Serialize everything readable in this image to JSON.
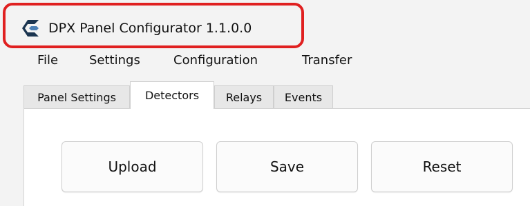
{
  "window": {
    "title": "DPX Panel Configurator 1.1.0.0",
    "icon": "app-logo-icon",
    "highlight_color": "#e02020"
  },
  "menu": {
    "items": [
      "File",
      "Settings",
      "Configuration",
      "Transfer"
    ]
  },
  "tabs": {
    "items": [
      "Panel Settings",
      "Detectors",
      "Relays",
      "Events"
    ],
    "active": "Detectors"
  },
  "buttons": {
    "upload_label": "Upload",
    "save_label": "Save",
    "reset_label": "Reset"
  }
}
